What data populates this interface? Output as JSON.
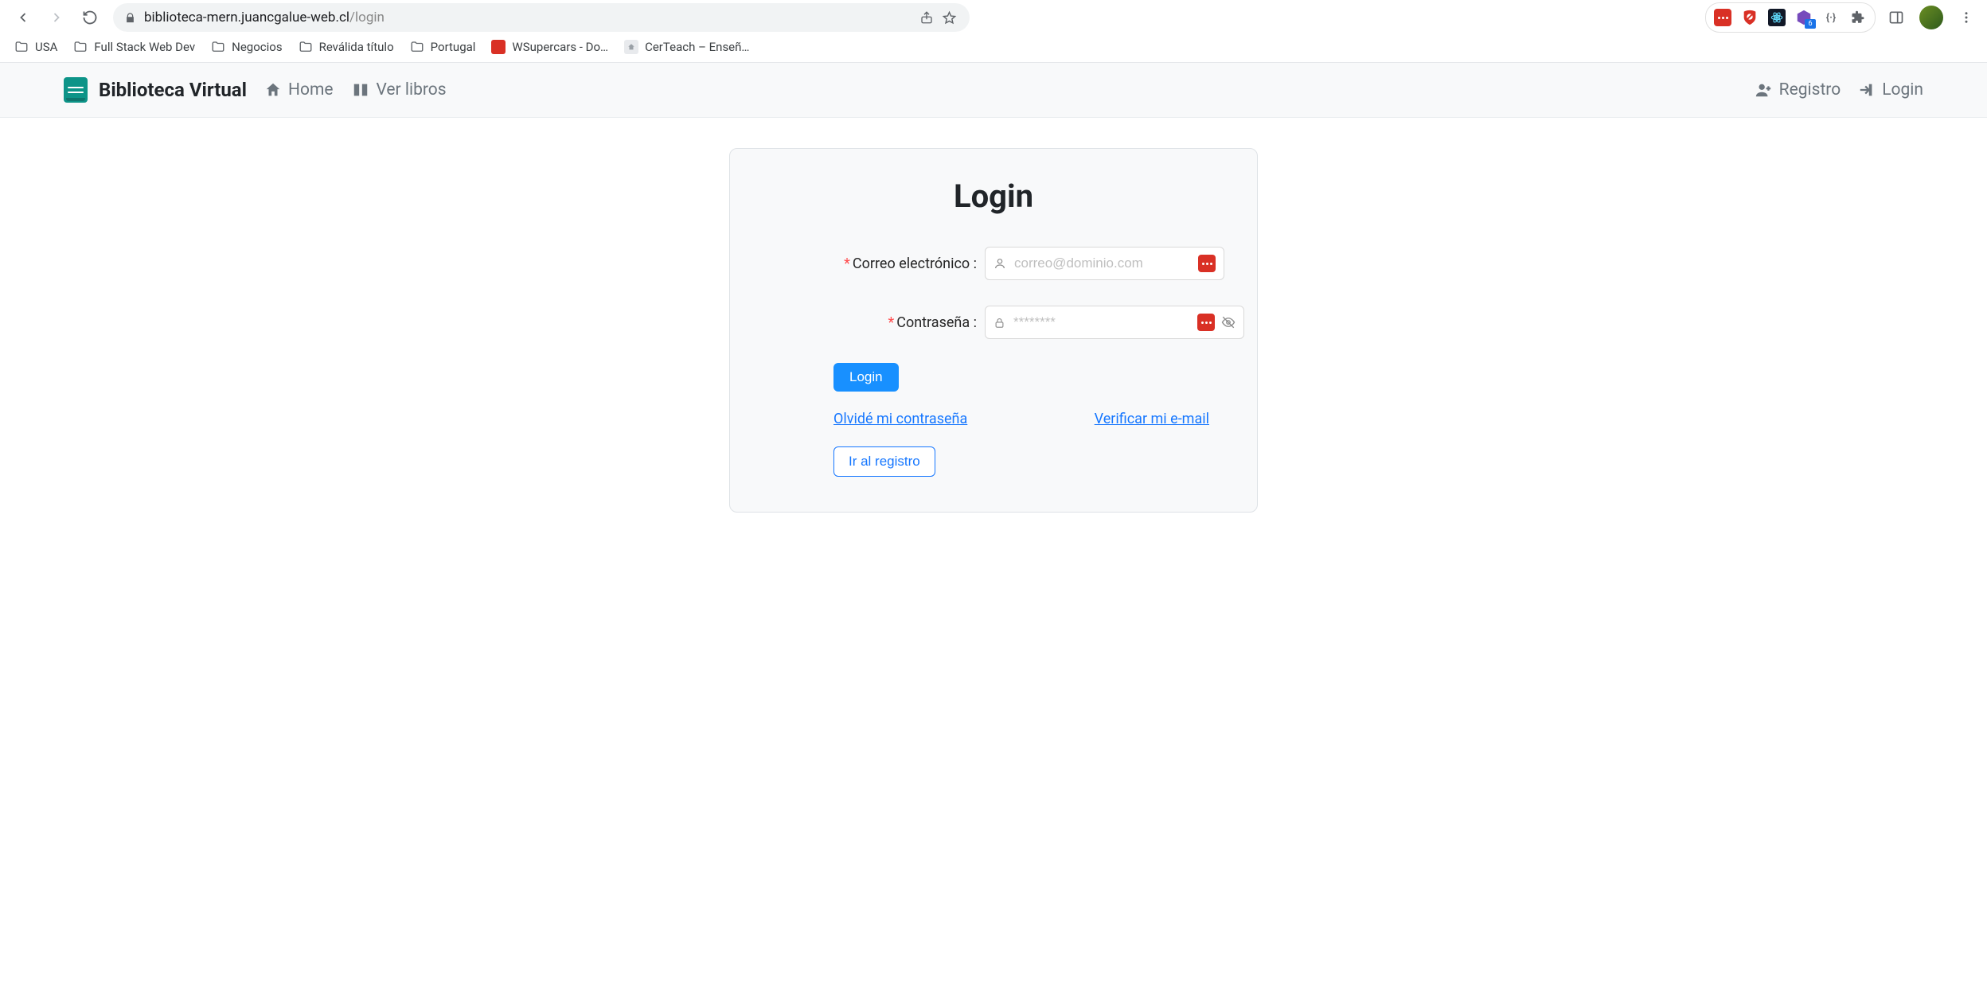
{
  "chrome": {
    "url_host": "biblioteca-mern.juancgalue-web.cl",
    "url_path": "/login",
    "ext_badge": "6"
  },
  "bookmarks": [
    {
      "type": "folder",
      "label": "USA"
    },
    {
      "type": "folder",
      "label": "Full Stack Web Dev"
    },
    {
      "type": "folder",
      "label": "Negocios"
    },
    {
      "type": "folder",
      "label": "Reválida título"
    },
    {
      "type": "folder",
      "label": "Portugal"
    },
    {
      "type": "site-red",
      "label": "WSupercars - Do…"
    },
    {
      "type": "site-light",
      "label": "CerTeach – Enseñ…"
    }
  ],
  "header": {
    "brand": "Biblioteca Virtual",
    "home": "Home",
    "ver_libros": "Ver libros",
    "registro": "Registro",
    "login": "Login"
  },
  "login": {
    "title": "Login",
    "email_label": "Correo electrónico",
    "email_placeholder": "correo@dominio.com",
    "password_label": "Contraseña",
    "password_placeholder": "********",
    "submit": "Login",
    "forgot": "Olvidé mi contraseña",
    "verify": "Verificar mi e-mail",
    "go_register": "Ir al registro"
  }
}
